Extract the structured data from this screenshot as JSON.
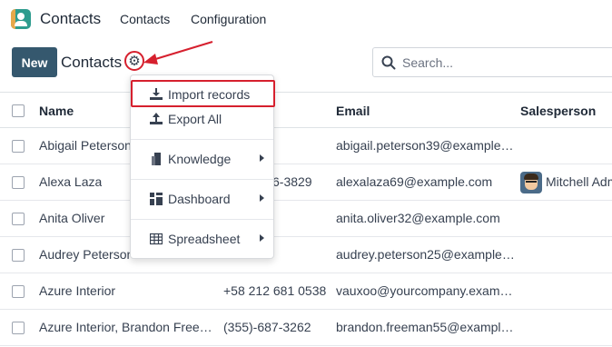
{
  "app": {
    "name": "Contacts",
    "logo_icon": "contacts-app-icon",
    "brand_color": "#2e9c8e"
  },
  "nav": {
    "items": [
      {
        "label": "Contacts"
      },
      {
        "label": "Configuration"
      }
    ]
  },
  "control_panel": {
    "new_label": "New",
    "breadcrumb": "Contacts",
    "settings_icon": "gear-icon",
    "search_placeholder": "Search..."
  },
  "table": {
    "columns": [
      "Name",
      "Email",
      "Salesperson"
    ],
    "rows": [
      {
        "name": "Abigail Peterson",
        "phone": "",
        "email": "abigail.peterson39@example…",
        "salesperson": ""
      },
      {
        "name": "Alexa Laza",
        "phone": "6-3829",
        "email": "alexalaza69@example.com",
        "salesperson": "Mitchell Adm"
      },
      {
        "name": "Anita Oliver",
        "phone": "",
        "email": "anita.oliver32@example.com",
        "salesperson": ""
      },
      {
        "name": "Audrey Peterson",
        "phone": "",
        "email": "audrey.peterson25@example…",
        "salesperson": ""
      },
      {
        "name": "Azure Interior",
        "phone": "+58 212 681 0538",
        "email": "vauxoo@yourcompany.exam…",
        "salesperson": ""
      },
      {
        "name": "Azure Interior, Brandon Free…",
        "phone": "(355)-687-3262",
        "email": "brandon.freeman55@exampl…",
        "salesperson": ""
      }
    ]
  },
  "menu": {
    "items": [
      {
        "label": "Import records",
        "icon": "download-icon",
        "highlighted": true
      },
      {
        "label": "Export All",
        "icon": "upload-icon"
      },
      {
        "label": "Knowledge",
        "icon": "bookmark-icon",
        "submenu": true
      },
      {
        "label": "Dashboard",
        "icon": "dashboard-icon",
        "submenu": true
      },
      {
        "label": "Spreadsheet",
        "icon": "table-icon",
        "submenu": true
      }
    ]
  },
  "annotation_color": "#d6202e"
}
